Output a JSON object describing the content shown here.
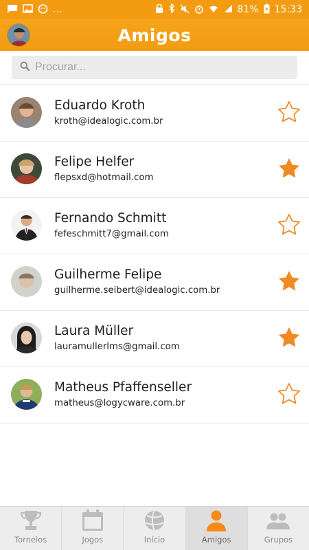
{
  "status_bar": {
    "battery": "81%",
    "time": "15:33",
    "more_indicator": "..."
  },
  "header": {
    "title": "Amigos"
  },
  "search": {
    "placeholder": "Procurar..."
  },
  "friends": [
    {
      "name": "Eduardo Kroth",
      "email": "kroth@idealogic.com.br",
      "favorite": false
    },
    {
      "name": "Felipe Helfer",
      "email": "flepsxd@hotmail.com",
      "favorite": true
    },
    {
      "name": "Fernando Schmitt",
      "email": "fefeschmitt7@gmail.com",
      "favorite": false
    },
    {
      "name": "Guilherme Felipe",
      "email": "guilherme.seibert@idealogic.com.br",
      "favorite": true
    },
    {
      "name": "Laura Müller",
      "email": "lauramullerlms@gmail.com",
      "favorite": true
    },
    {
      "name": "Matheus Pfaffenseller",
      "email": "matheus@logycware.com.br",
      "favorite": false
    }
  ],
  "tabs": [
    {
      "label": "Torneios",
      "icon": "trophy-icon",
      "active": false
    },
    {
      "label": "Jogos",
      "icon": "calendar-icon",
      "active": false
    },
    {
      "label": "Início",
      "icon": "home-ball-icon",
      "active": false
    },
    {
      "label": "Amigos",
      "icon": "person-icon",
      "active": true
    },
    {
      "label": "Grupos",
      "icon": "group-icon",
      "active": false
    }
  ],
  "colors": {
    "accent": "#f39c12",
    "star": "#f08a24",
    "tab_active_icon": "#f58a16",
    "tab_inactive_icon": "#bdbdbd"
  }
}
